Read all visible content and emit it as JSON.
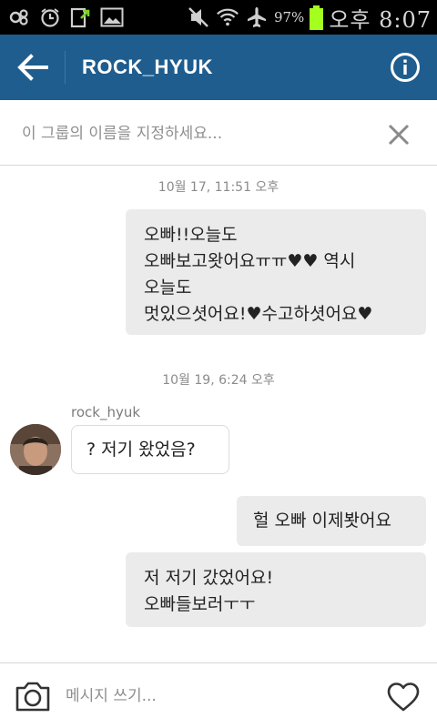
{
  "status_bar": {
    "battery_percent": "97%",
    "time": "오후 8:07",
    "icons": [
      "infinity-link-icon",
      "alarm-icon",
      "download-icon",
      "image-icon",
      "mute-icon",
      "wifi-icon",
      "airplane-icon",
      "battery-icon"
    ]
  },
  "header": {
    "title": "ROCK_HYUK",
    "back_icon": "arrow-left-icon",
    "info_icon": "info-icon",
    "background_color": "#1f5d8e"
  },
  "group_name": {
    "placeholder": "이 그룹의 이름을 지정하세요...",
    "value": "",
    "clear_icon": "close-icon"
  },
  "messages": [
    {
      "type": "timestamp",
      "text": "10월 17, 11:51 오후"
    },
    {
      "type": "outgoing",
      "text": "오빠!!오늘도\n오빠보고왓어요ㅠㅠ♥♥ 역시\n오늘도\n멋있으셧어요!♥수고하셧어요♥"
    },
    {
      "type": "timestamp",
      "text": "10월 19, 6:24 오후"
    },
    {
      "type": "incoming",
      "sender": "rock_hyuk",
      "text": "? 저기 왔었음?"
    },
    {
      "type": "outgoing",
      "text": "헐 오빠 이제봣어요"
    },
    {
      "type": "outgoing",
      "text": "저 저기 갔었어요!\n오빠들보러ㅜㅜ"
    }
  ],
  "composer": {
    "placeholder": "메시지 쓰기...",
    "value": "",
    "camera_icon": "camera-icon",
    "like_icon": "heart-icon"
  }
}
